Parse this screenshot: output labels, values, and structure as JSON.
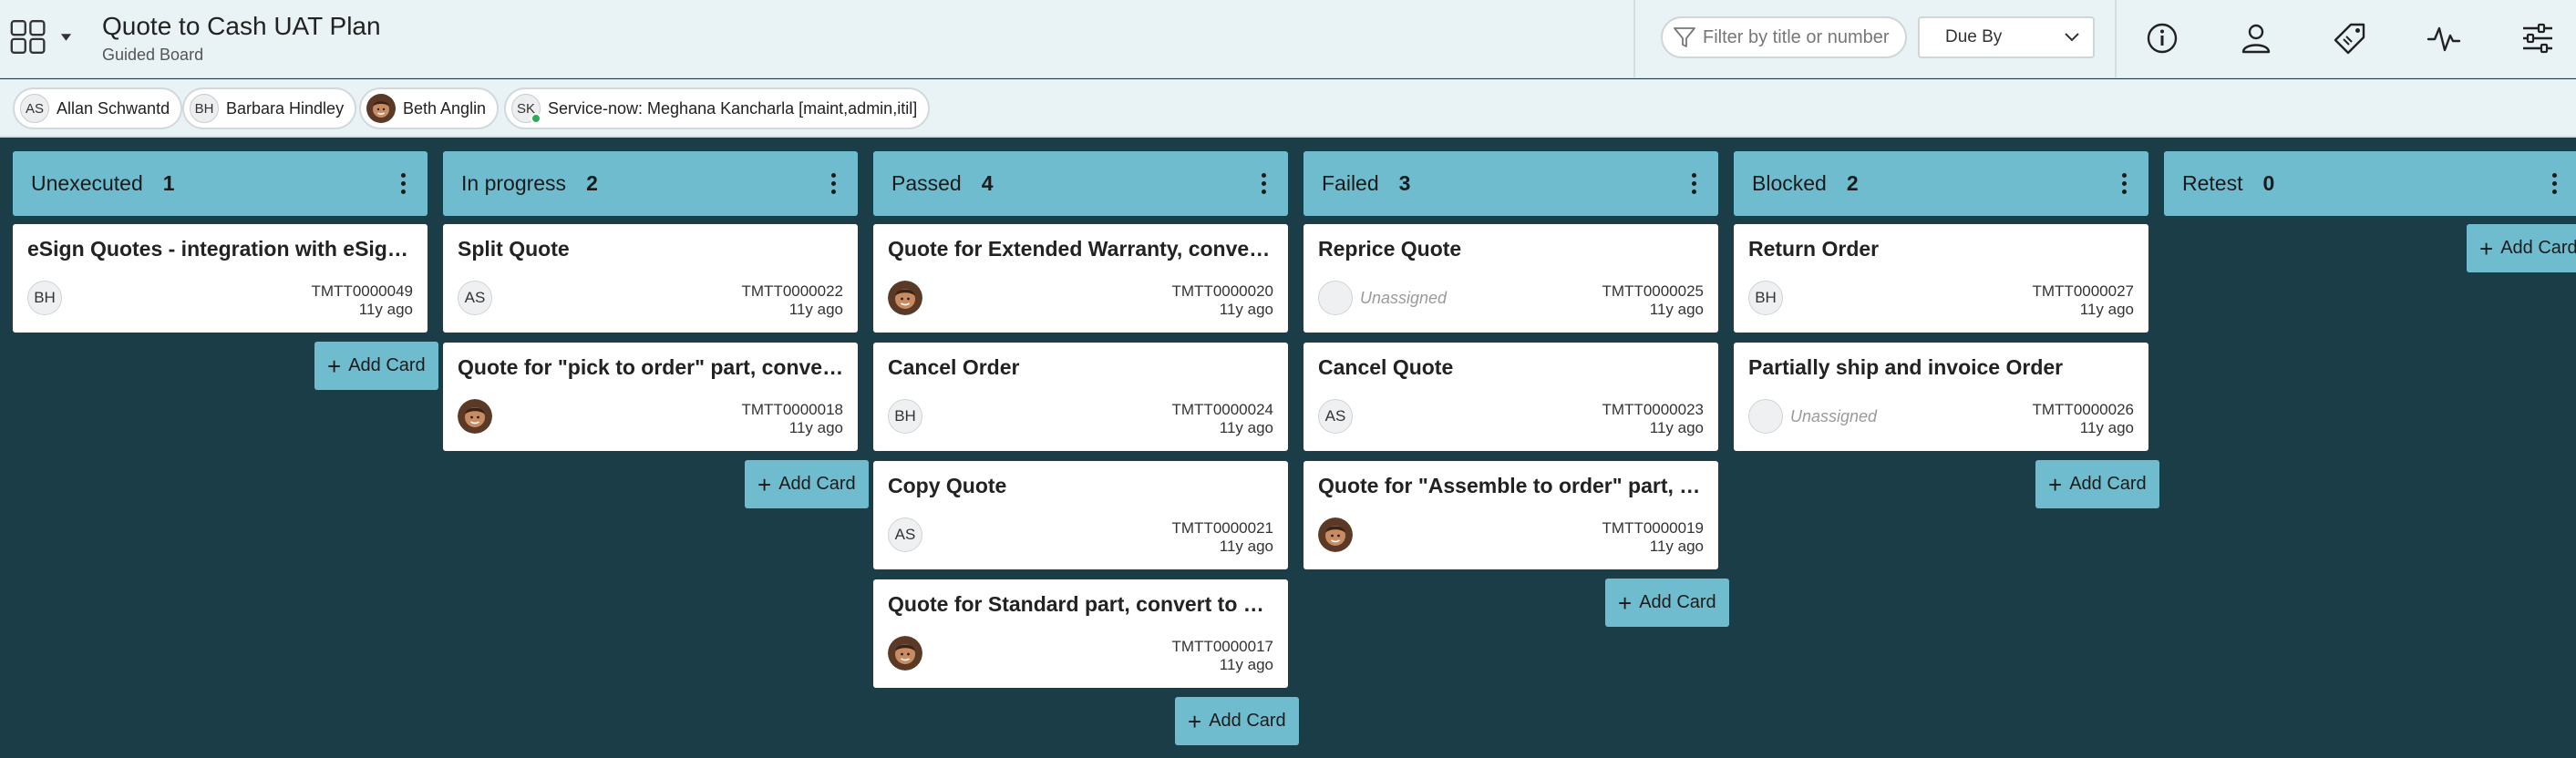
{
  "header": {
    "title": "Quote to Cash UAT Plan",
    "subtitle": "Guided Board",
    "filter_placeholder": "Filter by title or number",
    "sort_value": "Due By",
    "icons": [
      "info-icon",
      "user-icon",
      "tag-icon",
      "activity-icon",
      "settings-sliders-icon"
    ]
  },
  "participants": [
    {
      "initials": "AS",
      "name": "Allan Schwantd",
      "photo": false,
      "online": false
    },
    {
      "initials": "BH",
      "name": "Barbara Hindley",
      "photo": false,
      "online": false
    },
    {
      "initials": "",
      "name": "Beth Anglin",
      "photo": true,
      "online": false
    },
    {
      "initials": "SK",
      "name": "Service-now: Meghana Kancharla [maint,admin,itil]",
      "photo": false,
      "online": true
    }
  ],
  "add_card_label": "Add Card",
  "unassigned_label": "Unassigned",
  "colors": {
    "lane_header": "#70bccf",
    "board_bg": "#1b3d47",
    "header_bg": "#e9f3f5",
    "online": "#2eaa5c"
  },
  "lanes": [
    {
      "name": "Unexecuted",
      "count": "1",
      "cards": [
        {
          "title": "eSign Quotes - integration with eSign app",
          "assignee": "BH",
          "photo": false,
          "number": "TMTT0000049",
          "age": "11y ago"
        }
      ]
    },
    {
      "name": "In progress",
      "count": "2",
      "cards": [
        {
          "title": "Split Quote",
          "assignee": "AS",
          "photo": false,
          "number": "TMTT0000022",
          "age": "11y ago"
        },
        {
          "title": "Quote for \"pick to order\" part, convert to order",
          "assignee": "",
          "photo": true,
          "number": "TMTT0000018",
          "age": "11y ago"
        }
      ]
    },
    {
      "name": "Passed",
      "count": "4",
      "cards": [
        {
          "title": "Quote for Extended Warranty, convert to order",
          "assignee": "",
          "photo": true,
          "number": "TMTT0000020",
          "age": "11y ago"
        },
        {
          "title": "Cancel Order",
          "assignee": "BH",
          "photo": false,
          "number": "TMTT0000024",
          "age": "11y ago"
        },
        {
          "title": "Copy Quote",
          "assignee": "AS",
          "photo": false,
          "number": "TMTT0000021",
          "age": "11y ago"
        },
        {
          "title": "Quote for Standard part, convert to order",
          "assignee": "",
          "photo": true,
          "number": "TMTT0000017",
          "age": "11y ago"
        }
      ]
    },
    {
      "name": "Failed",
      "count": "3",
      "cards": [
        {
          "title": "Reprice Quote",
          "assignee": null,
          "photo": false,
          "number": "TMTT0000025",
          "age": "11y ago"
        },
        {
          "title": "Cancel Quote",
          "assignee": "AS",
          "photo": false,
          "number": "TMTT0000023",
          "age": "11y ago"
        },
        {
          "title": "Quote for \"Assemble to order\" part, convert to order",
          "assignee": "",
          "photo": true,
          "number": "TMTT0000019",
          "age": "11y ago"
        }
      ]
    },
    {
      "name": "Blocked",
      "count": "2",
      "cards": [
        {
          "title": "Return Order",
          "assignee": "BH",
          "photo": false,
          "number": "TMTT0000027",
          "age": "11y ago"
        },
        {
          "title": "Partially ship and invoice Order",
          "assignee": null,
          "photo": false,
          "number": "TMTT0000026",
          "age": "11y ago"
        }
      ]
    },
    {
      "name": "Retest",
      "count": "0",
      "cards": []
    }
  ]
}
